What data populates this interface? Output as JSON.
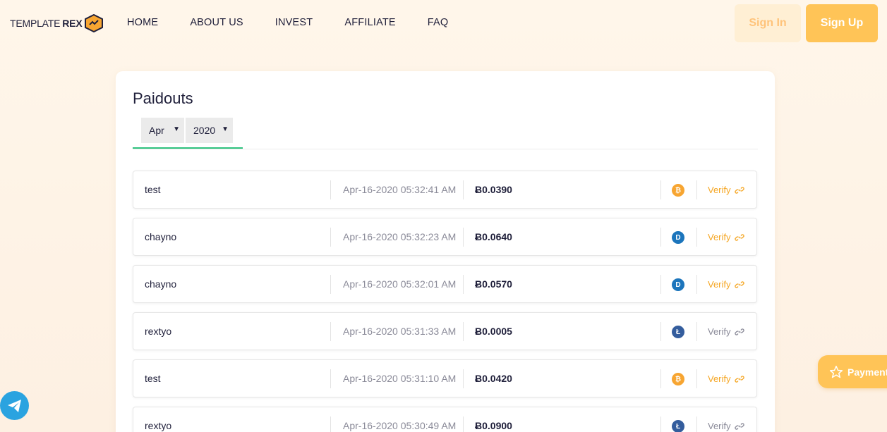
{
  "header": {
    "logo_text": "TEMPLATE",
    "logo_bold": "REX",
    "nav": [
      "HOME",
      "ABOUT US",
      "INVEST",
      "AFFILIATE",
      "FAQ"
    ],
    "signin_label": "Sign In",
    "signup_label": "Sign Up"
  },
  "paidouts": {
    "title": "Paidouts",
    "month": "Apr",
    "year": "2020",
    "rows": [
      {
        "user": "test",
        "date": "Apr-16-2020 05:32:41 AM",
        "amount": "Ƀ0.0390",
        "coin": "bitcoin-icon",
        "verify": "Verify",
        "verify_color": "#f5a623"
      },
      {
        "user": "chayno",
        "date": "Apr-16-2020 05:32:23 AM",
        "amount": "Ƀ0.0640",
        "coin": "dash-icon",
        "verify": "Verify",
        "verify_color": "#f5a623"
      },
      {
        "user": "chayno",
        "date": "Apr-16-2020 05:32:01 AM",
        "amount": "Ƀ0.0570",
        "coin": "dash-icon",
        "verify": "Verify",
        "verify_color": "#f5a623"
      },
      {
        "user": "rextyo",
        "date": "Apr-16-2020 05:31:33 AM",
        "amount": "Ƀ0.0005",
        "coin": "litecoin-icon",
        "verify": "Verify",
        "verify_color": "#8a8a98"
      },
      {
        "user": "test",
        "date": "Apr-16-2020 05:31:10 AM",
        "amount": "Ƀ0.0420",
        "coin": "bitcoin-icon",
        "verify": "Verify",
        "verify_color": "#f5a623"
      },
      {
        "user": "rextyo",
        "date": "Apr-16-2020 05:30:49 AM",
        "amount": "Ƀ0.0900",
        "coin": "litecoin-icon",
        "verify": "Verify",
        "verify_color": "#8a8a98"
      }
    ]
  },
  "floating": {
    "payment_label": "Payment"
  },
  "colors": {
    "accent": "#ffc457",
    "tab_underline": "#2ec27e",
    "bitcoin": "#f7a531",
    "dash": "#1c75bc",
    "litecoin": "#345d9d",
    "telegram": "#2aa3e0"
  }
}
